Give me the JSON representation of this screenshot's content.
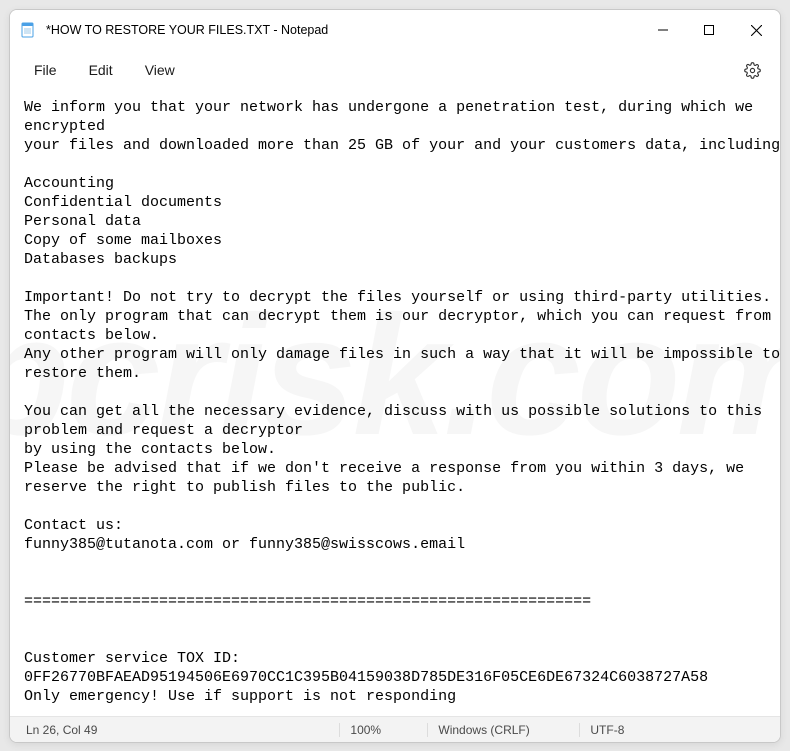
{
  "title": "*HOW TO RESTORE YOUR FILES.TXT - Notepad",
  "menu": {
    "file": "File",
    "edit": "Edit",
    "view": "View"
  },
  "body_text": "We inform you that your network has undergone a penetration test, during which we\nencrypted\nyour files and downloaded more than 25 GB of your and your customers data, including:\n\nAccounting\nConfidential documents\nPersonal data\nCopy of some mailboxes\nDatabases backups\n\nImportant! Do not try to decrypt the files yourself or using third-party utilities.\nThe only program that can decrypt them is our decryptor, which you can request from the\ncontacts below.\nAny other program will only damage files in such a way that it will be impossible to\nrestore them.\n\nYou can get all the necessary evidence, discuss with us possible solutions to this\nproblem and request a decryptor\nby using the contacts below.\nPlease be advised that if we don't receive a response from you within 3 days, we\nreserve the right to publish files to the public.\n\nContact us:\nfunny385@tutanota.com or funny385@swisscows.email\n\n\n===============================================================\n\n\nCustomer service TOX ID:\n0FF26770BFAEAD95194506E6970CC1C395B04159038D785DE316F05CE6DE67324C6038727A58\nOnly emergency! Use if support is not responding",
  "status": {
    "pos": "Ln 26, Col 49",
    "zoom": "100%",
    "eol": "Windows (CRLF)",
    "encoding": "UTF-8"
  },
  "watermark": "pcrisk.com"
}
